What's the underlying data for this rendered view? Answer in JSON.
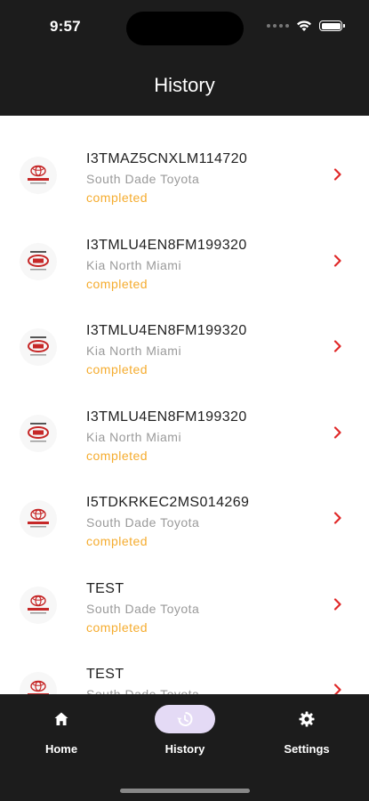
{
  "status_bar": {
    "time": "9:57"
  },
  "header": {
    "title": "History"
  },
  "history": {
    "items": [
      {
        "vin": "I3TMAZ5CNXLM114720",
        "dealer": "South Dade Toyota",
        "status": "completed",
        "logo": "toyota-logo"
      },
      {
        "vin": "I3TMLU4EN8FM199320",
        "dealer": "Kia North Miami",
        "status": "completed",
        "logo": "kia-logo"
      },
      {
        "vin": "I3TMLU4EN8FM199320",
        "dealer": "Kia North Miami",
        "status": "completed",
        "logo": "kia-logo"
      },
      {
        "vin": "I3TMLU4EN8FM199320",
        "dealer": "Kia North Miami",
        "status": "completed",
        "logo": "kia-logo"
      },
      {
        "vin": "I5TDKRKEC2MS014269",
        "dealer": "South Dade Toyota",
        "status": "completed",
        "logo": "toyota-logo"
      },
      {
        "vin": "TEST",
        "dealer": "South Dade Toyota",
        "status": "completed",
        "logo": "toyota-logo"
      },
      {
        "vin": "TEST",
        "dealer": "South Dade Toyota",
        "status": "",
        "logo": "toyota-logo"
      }
    ]
  },
  "tab_bar": {
    "tabs": [
      {
        "label": "Home",
        "icon": "home-icon"
      },
      {
        "label": "History",
        "icon": "history-icon",
        "active": true
      },
      {
        "label": "Settings",
        "icon": "gear-icon"
      }
    ]
  },
  "colors": {
    "status_completed": "#f5ac2f",
    "chevron": "#e02828",
    "active_tab_bg": "#e4daf5",
    "header_bg": "#1c1c1c"
  }
}
